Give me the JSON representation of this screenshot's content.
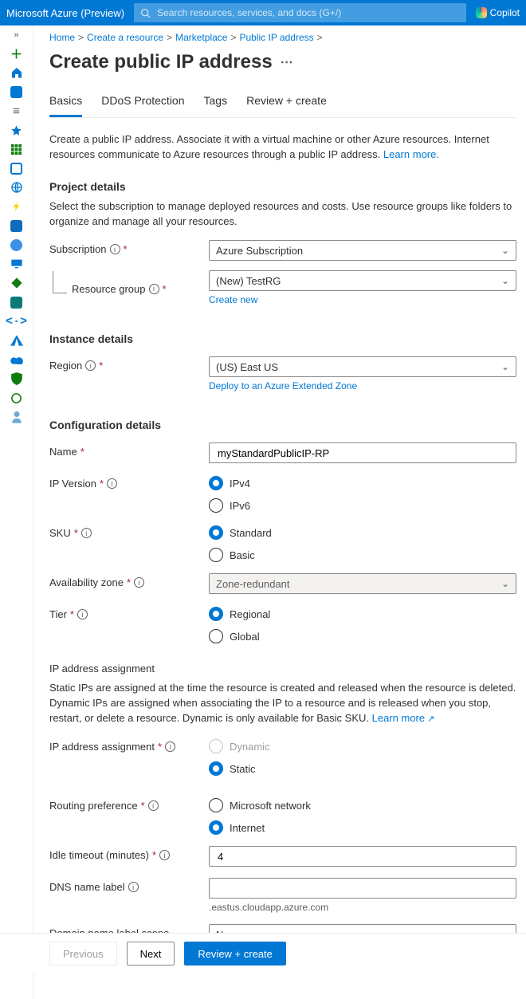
{
  "header": {
    "brand": "Microsoft Azure (Preview)",
    "search_placeholder": "Search resources, services, and docs (G+/)",
    "copilot": "Copilot"
  },
  "breadcrumb": [
    "Home",
    "Create a resource",
    "Marketplace",
    "Public IP address"
  ],
  "page_title": "Create public IP address",
  "tabs": {
    "basics": "Basics",
    "ddos": "DDoS Protection",
    "tags": "Tags",
    "review": "Review + create"
  },
  "intro": {
    "text": "Create a public IP address. Associate it with a virtual machine or other Azure resources. Internet resources communicate to Azure resources through a public IP address. ",
    "learn_more": "Learn more."
  },
  "sections": {
    "project": {
      "title": "Project details",
      "desc": "Select the subscription to manage deployed resources and costs. Use resource groups like folders to organize and manage all your resources.",
      "subscription_label": "Subscription",
      "subscription_value": "Azure Subscription",
      "rg_label": "Resource group",
      "rg_value": "(New) TestRG",
      "rg_create": "Create new"
    },
    "instance": {
      "title": "Instance details",
      "region_label": "Region",
      "region_value": "(US) East US",
      "extended_link": "Deploy to an Azure Extended Zone"
    },
    "config": {
      "title": "Configuration details",
      "name_label": "Name",
      "name_value": "myStandardPublicIP-RP",
      "ipv_label": "IP Version",
      "ipv_opts": {
        "ipv4": "IPv4",
        "ipv6": "IPv6"
      },
      "sku_label": "SKU",
      "sku_opts": {
        "std": "Standard",
        "basic": "Basic"
      },
      "az_label": "Availability zone",
      "az_value": "Zone-redundant",
      "tier_label": "Tier",
      "tier_opts": {
        "regional": "Regional",
        "global": "Global"
      },
      "ipa_title": "IP address assignment",
      "ipa_desc_pre": "Static IPs are assigned at the time the resource is created and released when the resource is deleted. Dynamic IPs are assigned when associating the IP to a resource and is released when you stop, restart, or delete a resource. Dynamic is only available for Basic SKU. ",
      "ipa_learn": "Learn more",
      "ipa_label": "IP address assignment",
      "ipa_opts": {
        "dynamic": "Dynamic",
        "static": "Static"
      },
      "routing_label": "Routing preference",
      "routing_opts": {
        "ms": "Microsoft network",
        "internet": "Internet"
      },
      "idle_label": "Idle timeout (minutes)",
      "idle_value": "4",
      "dns_label": "DNS name label",
      "dns_suffix": ".eastus.cloudapp.azure.com",
      "domain_label": "Domain name label scope (preview)",
      "domain_value": "None"
    }
  },
  "footer": {
    "prev": "Previous",
    "next": "Next",
    "review": "Review + create"
  }
}
